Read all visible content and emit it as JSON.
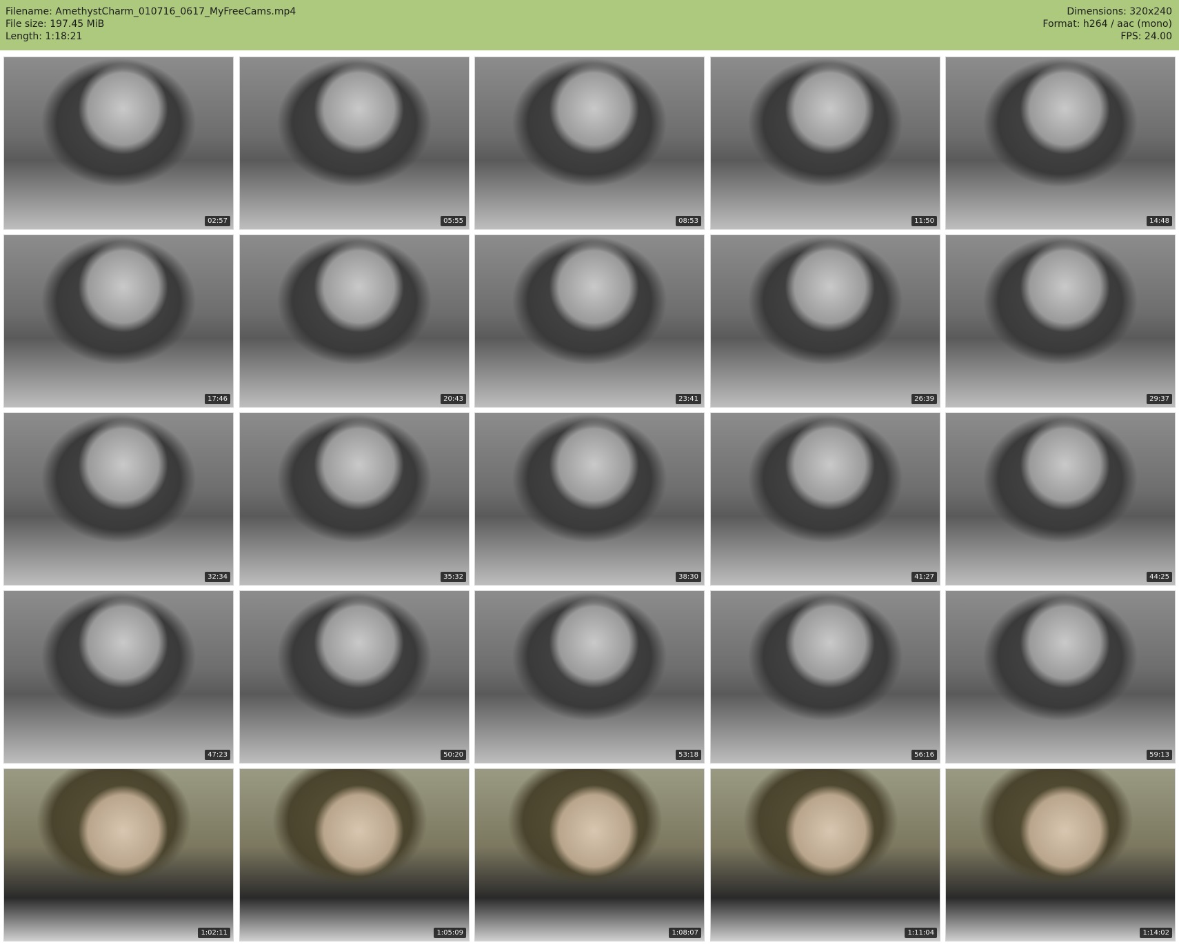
{
  "header": {
    "filename": "Filename: AmethystCharm_010716_0617_MyFreeCams.mp4",
    "filesize": "File size: 197.45 MiB",
    "length": "Length: 1:18:21",
    "dimensions": "Dimensions: 320x240",
    "format": "Format: h264 / aac (mono)",
    "fps": "FPS: 24.00"
  },
  "thumbnails": [
    {
      "time": "02:57",
      "tone": "gray"
    },
    {
      "time": "05:55",
      "tone": "gray"
    },
    {
      "time": "08:53",
      "tone": "gray"
    },
    {
      "time": "11:50",
      "tone": "gray"
    },
    {
      "time": "14:48",
      "tone": "gray"
    },
    {
      "time": "17:46",
      "tone": "gray"
    },
    {
      "time": "20:43",
      "tone": "gray"
    },
    {
      "time": "23:41",
      "tone": "gray"
    },
    {
      "time": "26:39",
      "tone": "gray"
    },
    {
      "time": "29:37",
      "tone": "gray"
    },
    {
      "time": "32:34",
      "tone": "gray"
    },
    {
      "time": "35:32",
      "tone": "gray"
    },
    {
      "time": "38:30",
      "tone": "gray"
    },
    {
      "time": "41:27",
      "tone": "gray"
    },
    {
      "time": "44:25",
      "tone": "gray"
    },
    {
      "time": "47:23",
      "tone": "gray"
    },
    {
      "time": "50:20",
      "tone": "gray"
    },
    {
      "time": "53:18",
      "tone": "gray"
    },
    {
      "time": "56:16",
      "tone": "gray"
    },
    {
      "time": "59:13",
      "tone": "gray"
    },
    {
      "time": "1:02:11",
      "tone": "color"
    },
    {
      "time": "1:05:09",
      "tone": "color"
    },
    {
      "time": "1:08:07",
      "tone": "color"
    },
    {
      "time": "1:11:04",
      "tone": "color"
    },
    {
      "time": "1:14:02",
      "tone": "color"
    }
  ],
  "colors": {
    "header_bg": "#acc97e",
    "gray_scene": "#7a7a7a",
    "color_scene": "#8a8262"
  }
}
